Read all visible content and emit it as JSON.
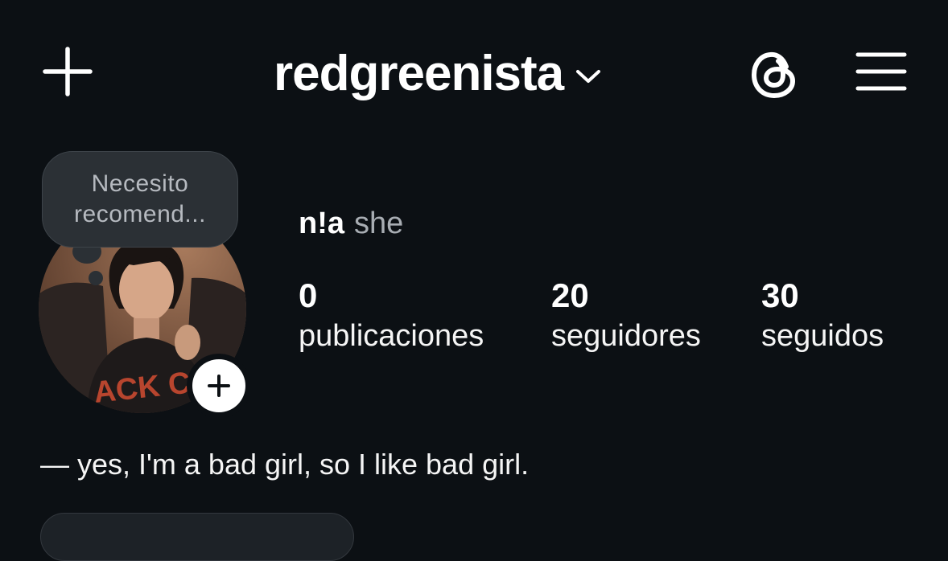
{
  "header": {
    "create_icon": "plus-icon",
    "username": "redgreenista",
    "account_switch_icon": "chevron-down-icon",
    "threads_icon": "threads-icon",
    "menu_icon": "hamburger-menu-icon"
  },
  "note": {
    "line1": "Necesito",
    "line2": "recomend..."
  },
  "profile": {
    "avatar": "profile-photo",
    "add_story_icon": "plus-icon",
    "display_name": "n!a",
    "pronouns": "she",
    "bio": "— yes, I'm a bad girl, so I like bad girl."
  },
  "stats": [
    {
      "value": "0",
      "label": "publicaciones"
    },
    {
      "value": "20",
      "label": "seguidores"
    },
    {
      "value": "30",
      "label": "seguidos"
    }
  ],
  "colors": {
    "background": "#0c1014",
    "text": "#f5f5f5",
    "muted": "#a8adb3",
    "note_bg": "#2b3035"
  }
}
